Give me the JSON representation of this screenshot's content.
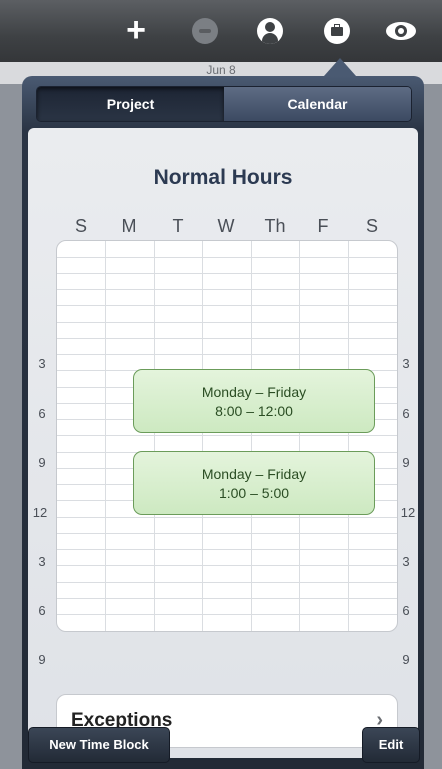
{
  "toolbar": {
    "icons": [
      "plus-icon",
      "minus-icon",
      "person-icon",
      "briefcase-icon",
      "eye-icon"
    ]
  },
  "background": {
    "date_label": "Jun 8"
  },
  "popover": {
    "tabs": [
      {
        "label": "Project",
        "active": false
      },
      {
        "label": "Calendar",
        "active": true
      }
    ],
    "title": "Normal Hours",
    "days": [
      "S",
      "M",
      "T",
      "W",
      "Th",
      "F",
      "S"
    ],
    "hours_left": [
      "3",
      "6",
      "9",
      "12",
      "3",
      "6",
      "9"
    ],
    "hours_right": [
      "3",
      "6",
      "9",
      "12",
      "3",
      "6",
      "9"
    ],
    "time_blocks": [
      {
        "days": "Monday – Friday",
        "time": "8:00 – 12:00"
      },
      {
        "days": "Monday – Friday",
        "time": "1:00 – 5:00"
      }
    ],
    "exceptions_label": "Exceptions",
    "new_time_block_label": "New Time Block",
    "edit_label": "Edit"
  },
  "colors": {
    "time_block_fill": "#d6ecca",
    "time_block_border": "#6b9c5a",
    "title_color": "#2c3a52"
  }
}
